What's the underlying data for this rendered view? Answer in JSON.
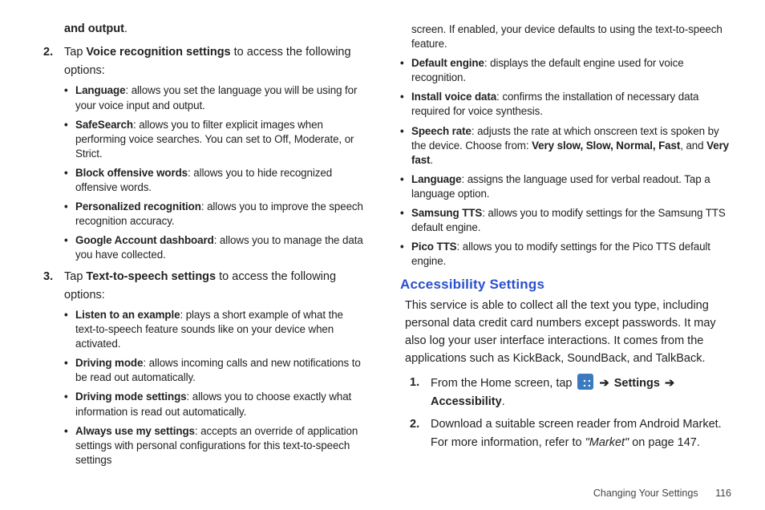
{
  "left": {
    "fragA_pre": "and output",
    "step2_pre": "Tap ",
    "step2_bold": "Voice recognition settings",
    "step2_post": " to access the following",
    "options_word": "options:",
    "voice_bullets": [
      {
        "bold": "Language",
        "text": ": allows you set the language you will be using for your voice input and output."
      },
      {
        "bold": "SafeSearch",
        "text": ": allows you to filter explicit images when performing voice searches. You can set to Off, Moderate, or Strict."
      },
      {
        "bold": "Block offensive words",
        "text": ": allows you to hide recognized offensive words."
      },
      {
        "bold": "Personalized recognition",
        "text": ": allows you to improve the speech recognition accuracy."
      },
      {
        "bold": "Google Account dashboard",
        "text": ": allows you to manage the data you have collected."
      }
    ],
    "step3_pre": "Tap ",
    "step3_bold": "Text-to-speech settings",
    "step3_post": " to access the following",
    "tts_bullets_a": [
      {
        "bold": "Listen to an example",
        "text": ": plays a short example of what the text-to-speech feature sounds like on your device when activated."
      },
      {
        "bold": "Driving mode",
        "text": ": allows incoming calls and new notifications to be read out automatically."
      },
      {
        "bold": "Driving mode settings",
        "text": ": allows you to choose exactly what information is read out automatically."
      },
      {
        "bold": "Always use my settings",
        "text": ": accepts an override of application settings with personal configurations for this text-to-speech settings"
      }
    ]
  },
  "right": {
    "carry": "screen. If enabled, your device defaults to using the text-to-speech feature.",
    "tts_bullets_b": [
      {
        "bold": "Default engine",
        "text": ": displays the default engine used for voice recognition."
      },
      {
        "bold": "Install voice data",
        "text": ": confirms the installation of necessary data required for voice synthesis."
      },
      {
        "bold": "Speech rate",
        "text": ": adjusts the rate at which onscreen text is spoken by the device. Choose from: ",
        "extra_bold": "Very slow, Slow, Normal, Fast",
        "extra_mid": ", and ",
        "extra_bold2": "Very fast",
        "tail": "."
      },
      {
        "bold": "Language",
        "text": ": assigns the language used for verbal readout. Tap a language option."
      },
      {
        "bold": "Samsung TTS",
        "text": ": allows you to modify settings for the Samsung TTS default engine."
      },
      {
        "bold": "Pico TTS",
        "text": ": allows you to modify settings for the Pico TTS default engine."
      }
    ],
    "h2": "Accessibility Settings",
    "acc_para": "This service is able to collect all the text you type, including personal data credit card numbers except passwords. It may also log your user interface interactions. It comes from the applications such as KickBack, SoundBack, and TalkBack.",
    "step1_pre": "From the Home screen, tap ",
    "arrow": "➔",
    "step1_settings": "Settings",
    "step1_acc": "Accessibility",
    "step2a": "Download a suitable screen reader from Android Market.",
    "step2b_pre": "For more information, refer to ",
    "step2b_ital": "\"Market\"",
    "step2b_post": "  on page 147."
  },
  "footer": {
    "section": "Changing Your Settings",
    "page": "116"
  },
  "nums": {
    "n1": "1.",
    "n2": "2.",
    "n3": "3."
  }
}
